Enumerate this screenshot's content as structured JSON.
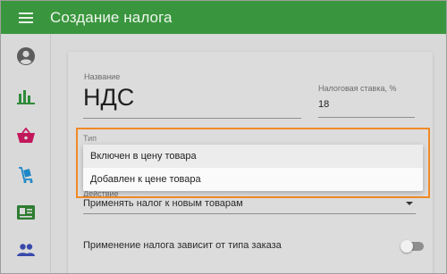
{
  "app_title": "Создание налога",
  "colors": {
    "appbar": "#3a963e",
    "accent_icons": [
      "#5a5a5a",
      "#2e8b3a",
      "#c2185b",
      "#1e88c7",
      "#2e7d32",
      "#3949ab"
    ]
  },
  "sidebar": {
    "items": [
      {
        "icon": "account-circle-icon"
      },
      {
        "icon": "bar-chart-icon"
      },
      {
        "icon": "basket-icon"
      },
      {
        "icon": "delivery-cart-icon"
      },
      {
        "icon": "contact-card-icon"
      },
      {
        "icon": "people-icon"
      }
    ]
  },
  "form": {
    "name": {
      "label": "Название",
      "value": "НДС"
    },
    "rate": {
      "label": "Налоговая ставка, %",
      "value": "18"
    },
    "type": {
      "label": "Тип",
      "options": [
        "Включен в цену товара",
        "Добавлен к цене товара"
      ],
      "highlighted_index": 0
    },
    "action": {
      "label_partial": "Действие",
      "value": "Применять налог к новым товарам"
    },
    "order_type_toggle": {
      "label": "Применение налога зависит от типа заказа",
      "state": "off"
    }
  }
}
